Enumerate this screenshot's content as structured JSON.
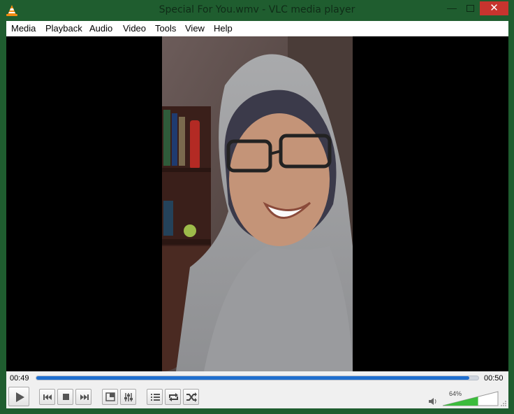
{
  "window": {
    "title": "Special For You.wmv - VLC media player",
    "accent": "#1f5d2f",
    "close_color": "#c7342e",
    "minimize_glyph": "—",
    "close_glyph": "✕"
  },
  "menu": {
    "media": "Media",
    "playback": "Playback",
    "audio": "Audio",
    "video": "Video",
    "tools": "Tools",
    "view": "View",
    "help": "Help"
  },
  "player": {
    "time_elapsed": "00:49",
    "time_total": "00:50",
    "seek_progress": 0.98,
    "seek_color": "#1f6fcf",
    "volume_percent_label": "64%",
    "volume_level": 0.64,
    "volume_color": "#3cbc3c"
  },
  "controls": {
    "icons": [
      "play-icon",
      "previous-icon",
      "stop-icon",
      "next-icon",
      "fullscreen-icon",
      "extended-settings-icon",
      "playlist-icon",
      "loop-icon",
      "shuffle-icon",
      "speaker-icon"
    ]
  }
}
